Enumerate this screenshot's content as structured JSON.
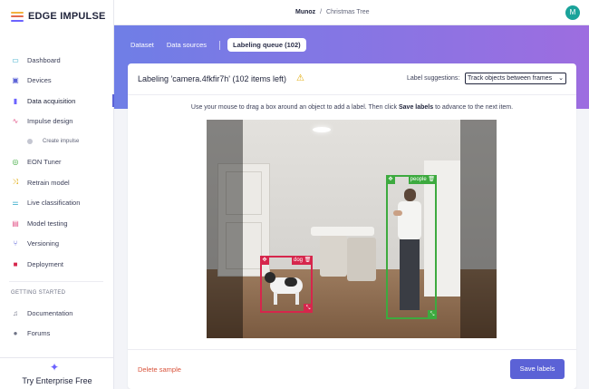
{
  "brand": {
    "name": "EDGE IMPULSE",
    "bar_colors": [
      "#f2b33d",
      "#e36a4a",
      "#6c63ff"
    ]
  },
  "sidebar": {
    "items": [
      {
        "label": "Dashboard",
        "icon": "monitor-icon",
        "color": "#2aa6c7"
      },
      {
        "label": "Devices",
        "icon": "cpu-icon",
        "color": "#5b62d6"
      },
      {
        "label": "Data acquisition",
        "icon": "database-icon",
        "color": "#6c63ff",
        "active": true
      },
      {
        "label": "Impulse design",
        "icon": "pulse-icon",
        "color": "#e3578a"
      },
      {
        "label": "Create impulse",
        "icon": "dot-icon",
        "color": "#c4c6d1",
        "sub": true
      },
      {
        "label": "EON Tuner",
        "icon": "target-icon",
        "color": "#3daa3f"
      },
      {
        "label": "Retrain model",
        "icon": "shuffle-icon",
        "color": "#e0a800"
      },
      {
        "label": "Live classification",
        "icon": "sliders-icon",
        "color": "#2aa6c7"
      },
      {
        "label": "Model testing",
        "icon": "clipboard-icon",
        "color": "#e3578a"
      },
      {
        "label": "Versioning",
        "icon": "branch-icon",
        "color": "#5b62d6"
      },
      {
        "label": "Deployment",
        "icon": "package-icon",
        "color": "#d6264c"
      }
    ],
    "section_title": "GETTING STARTED",
    "getting_started": [
      {
        "label": "Documentation",
        "icon": "book-icon",
        "color": "#6e7285"
      },
      {
        "label": "Forums",
        "icon": "chat-icon",
        "color": "#6e7285"
      }
    ],
    "enterprise_label": "Try Enterprise Free"
  },
  "topbar": {
    "user": "Munoz",
    "separator": "/",
    "project": "Christmas Tree",
    "avatar_initial": "M"
  },
  "tabs": [
    {
      "label": "Dataset"
    },
    {
      "label": "Data sources"
    },
    {
      "label": "Labeling queue (102)",
      "active": true
    }
  ],
  "labeling": {
    "title": "Labeling 'camera.4fkfir7h' (102 items left)",
    "suggestions_label": "Label suggestions:",
    "suggestions_value": "Track objects between frames",
    "instruction_pre": "Use your mouse to drag a box around an object to add a label. Then click ",
    "instruction_bold": "Save labels",
    "instruction_post": " to advance to the next item.",
    "boxes": [
      {
        "label": "dog",
        "color": "#d6264c"
      },
      {
        "label": "people",
        "color": "#3daa3f"
      }
    ],
    "delete_label": "Delete sample",
    "save_label": "Save labels"
  }
}
